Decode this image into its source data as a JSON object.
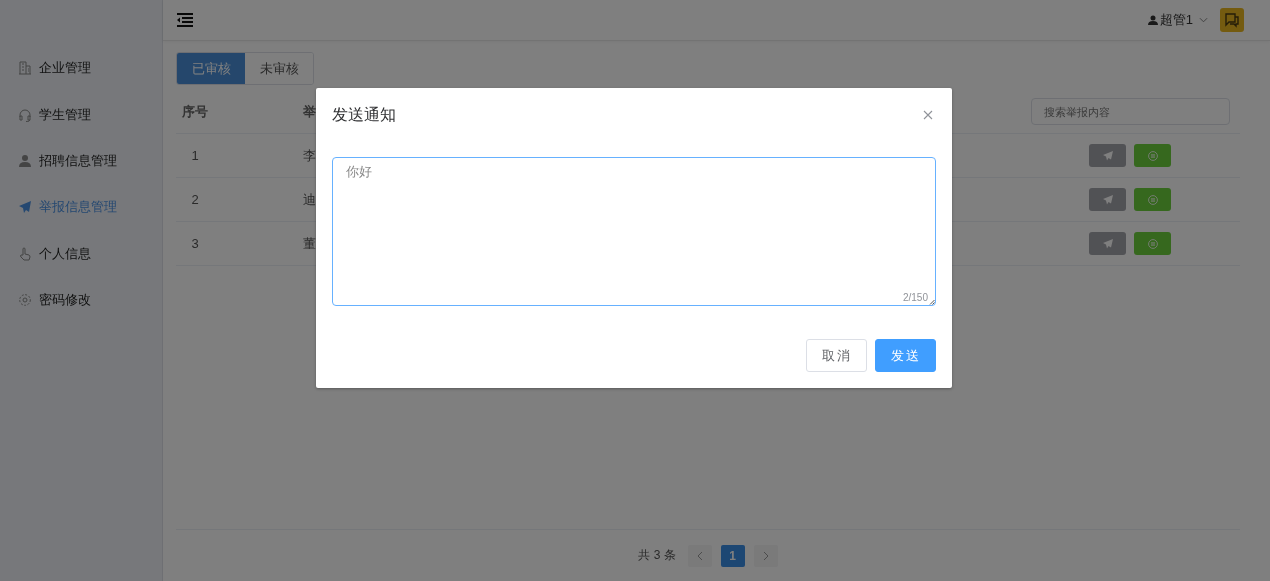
{
  "sidebar": {
    "items": [
      {
        "label": "企业管理",
        "selected": false
      },
      {
        "label": "学生管理",
        "selected": false
      },
      {
        "label": "招聘信息管理",
        "selected": false
      },
      {
        "label": "举报信息管理",
        "selected": true
      },
      {
        "label": "个人信息",
        "selected": false
      },
      {
        "label": "密码修改",
        "selected": false
      }
    ]
  },
  "header": {
    "user": "超管1"
  },
  "tabs": [
    {
      "label": "已审核",
      "selected": true
    },
    {
      "label": "未审核",
      "selected": false
    }
  ],
  "table": {
    "columns": [
      "序号",
      "举"
    ],
    "search": {
      "placeholder": "搜索举报内容"
    },
    "rows": [
      {
        "index": "1",
        "column_2": "李"
      },
      {
        "index": "2",
        "column_2": "迪"
      },
      {
        "index": "3",
        "column_2": "董"
      }
    ]
  },
  "pagination": {
    "total": "共 3 条",
    "pages": [
      {
        "label": "1",
        "selected": true
      }
    ]
  },
  "dialog": {
    "title": "发送通知",
    "message": {
      "value": "你好",
      "counter": "2/150"
    },
    "buttons": [
      {
        "label": "取消",
        "kind": "default"
      },
      {
        "label": "发送",
        "kind": "primary"
      }
    ]
  }
}
